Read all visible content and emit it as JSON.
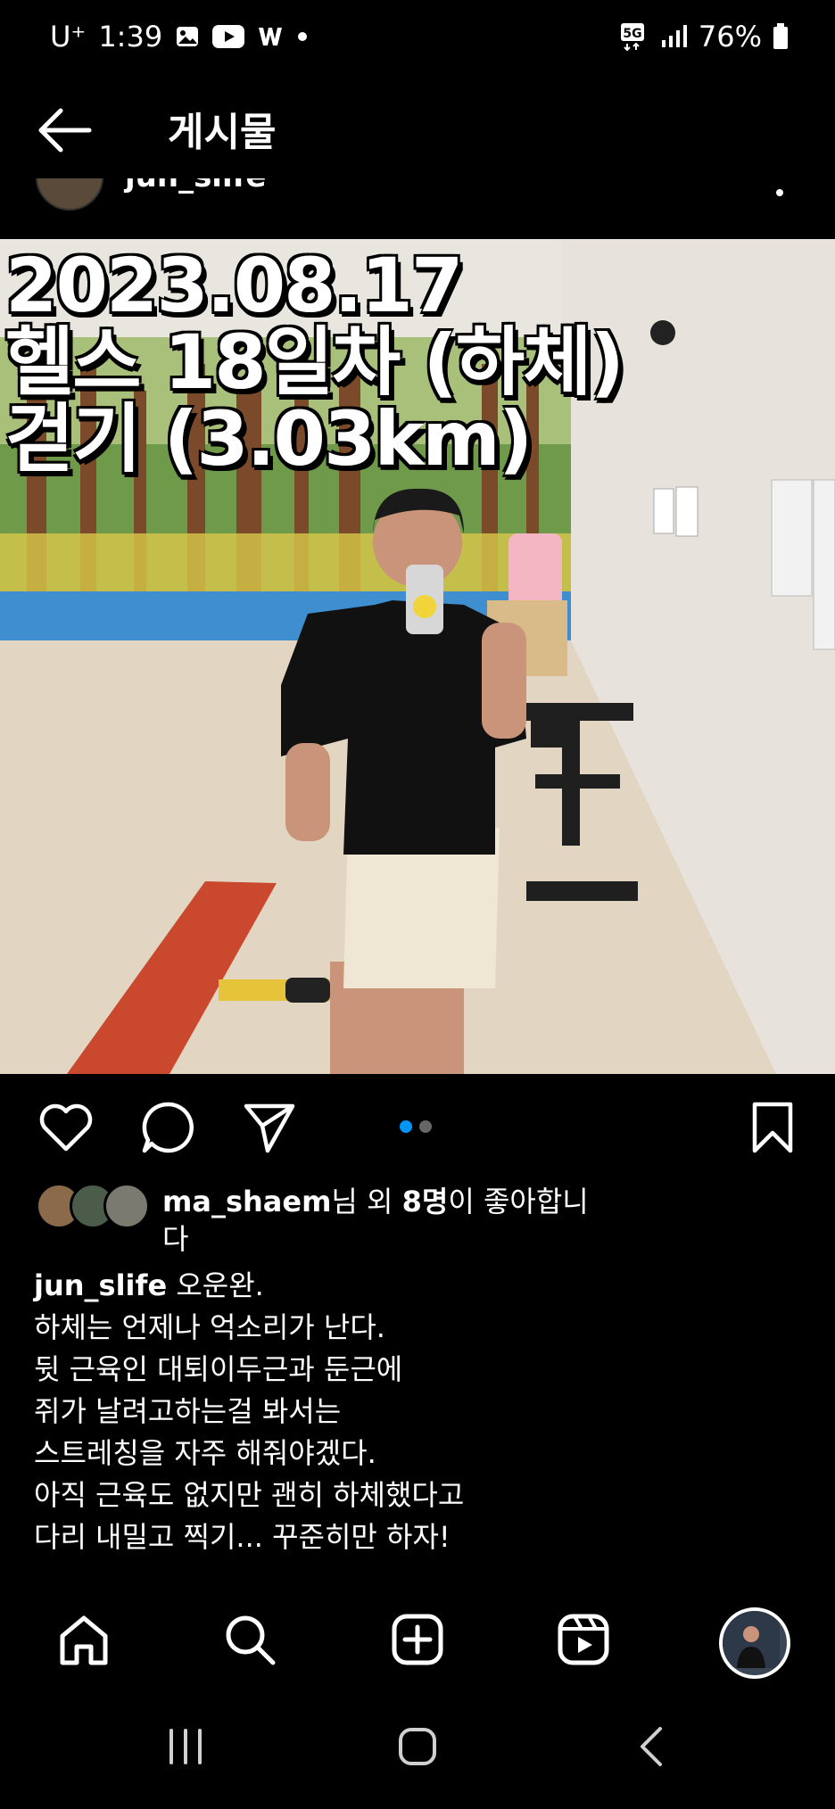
{
  "status_bar": {
    "carrier": "U⁺",
    "time": "1:39",
    "network": "5G",
    "battery": "76%"
  },
  "header": {
    "title": "게시물"
  },
  "post": {
    "author": "jun_slife",
    "overlay_lines": [
      "2023.08.17",
      "헬스 18일차 (하체)",
      "걷기 (3.03km)"
    ],
    "carousel": {
      "count": 2,
      "active_index": 0
    }
  },
  "likes": {
    "user": "ma_shaem",
    "suffix_1": "님 외 ",
    "count": "8명",
    "suffix_2": "이 좋아합니",
    "suffix_3": "다"
  },
  "caption": {
    "user": "jun_slife",
    "first_line": " 오운완.",
    "lines": [
      "하체는 언제나 억소리가 난다.",
      "뒷 근육인 대퇴이두근과 둔근에",
      "쥐가 날려고하는걸 봐서는",
      "스트레칭을 자주 해줘야겠다.",
      "아직 근육도 없지만 괜히 하체했다고",
      "다리 내밀고 찍기... 꾸준히만 하자!"
    ]
  },
  "colors": {
    "background": "#000000",
    "accent": "#0095f6",
    "text": "#ffffff"
  }
}
